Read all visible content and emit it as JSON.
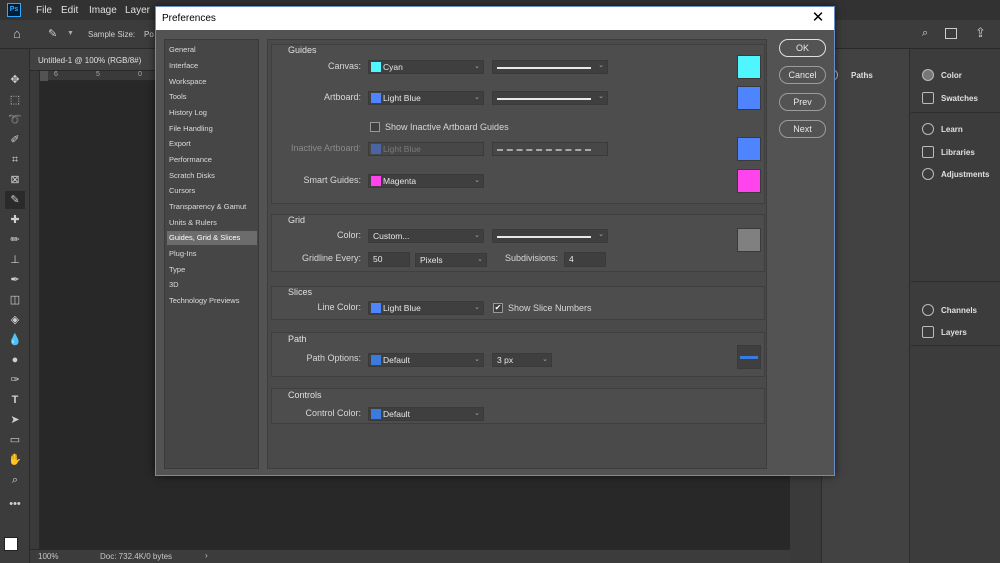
{
  "app": {
    "logo": "Ps",
    "menu": [
      "File",
      "Edit",
      "Image",
      "Layer"
    ]
  },
  "options_bar": {
    "sample_size_label": "Sample Size:",
    "sample_size_value": "Po"
  },
  "document": {
    "tab_title": "Untitled-1 @ 100% (RGB/8#)",
    "ruler_ticks": [
      "6",
      "5",
      "0"
    ],
    "zoom": "100%",
    "doc_size": "Doc: 732.4K/0 bytes"
  },
  "right_dock": {
    "paths": "Paths",
    "panels_a": [
      "Color",
      "Swatches"
    ],
    "panels_b": [
      "Learn",
      "Libraries",
      "Adjustments"
    ],
    "panels_c": [
      "Channels",
      "Layers"
    ]
  },
  "dialog": {
    "title": "Preferences",
    "categories": [
      "General",
      "Interface",
      "Workspace",
      "Tools",
      "History Log",
      "File Handling",
      "Export",
      "Performance",
      "Scratch Disks",
      "Cursors",
      "Transparency & Gamut",
      "Units & Rulers",
      "Guides, Grid & Slices",
      "Plug-Ins",
      "Type",
      "3D",
      "Technology Previews"
    ],
    "selected_category": "Guides, Grid & Slices",
    "buttons": {
      "ok": "OK",
      "cancel": "Cancel",
      "prev": "Prev",
      "next": "Next"
    },
    "guides": {
      "title": "Guides",
      "canvas_label": "Canvas:",
      "canvas_value": "Cyan",
      "canvas_color": "#4ff5ff",
      "artboard_label": "Artboard:",
      "artboard_value": "Light Blue",
      "artboard_color": "#4f84ff",
      "show_inactive_label": "Show Inactive Artboard Guides",
      "show_inactive_checked": false,
      "inactive_label": "Inactive Artboard:",
      "inactive_value": "Light Blue",
      "inactive_color": "#4f84ff",
      "smart_label": "Smart Guides:",
      "smart_value": "Magenta",
      "smart_color": "#ff44ee"
    },
    "grid": {
      "title": "Grid",
      "color_label": "Color:",
      "color_value": "Custom...",
      "color_swatch": "#808080",
      "gridline_label": "Gridline Every:",
      "gridline_value": "50",
      "gridline_unit": "Pixels",
      "subdivisions_label": "Subdivisions:",
      "subdivisions_value": "4"
    },
    "slices": {
      "title": "Slices",
      "line_color_label": "Line Color:",
      "line_color_value": "Light Blue",
      "line_color": "#4f84ff",
      "show_numbers_label": "Show Slice Numbers",
      "show_numbers_checked": true
    },
    "path": {
      "title": "Path",
      "options_label": "Path Options:",
      "options_value": "Default",
      "options_color": "#3a7be0",
      "width_value": "3 px",
      "preview_color": "#3a7be0"
    },
    "controls": {
      "title": "Controls",
      "color_label": "Control Color:",
      "color_value": "Default",
      "color": "#3a7be0"
    }
  }
}
